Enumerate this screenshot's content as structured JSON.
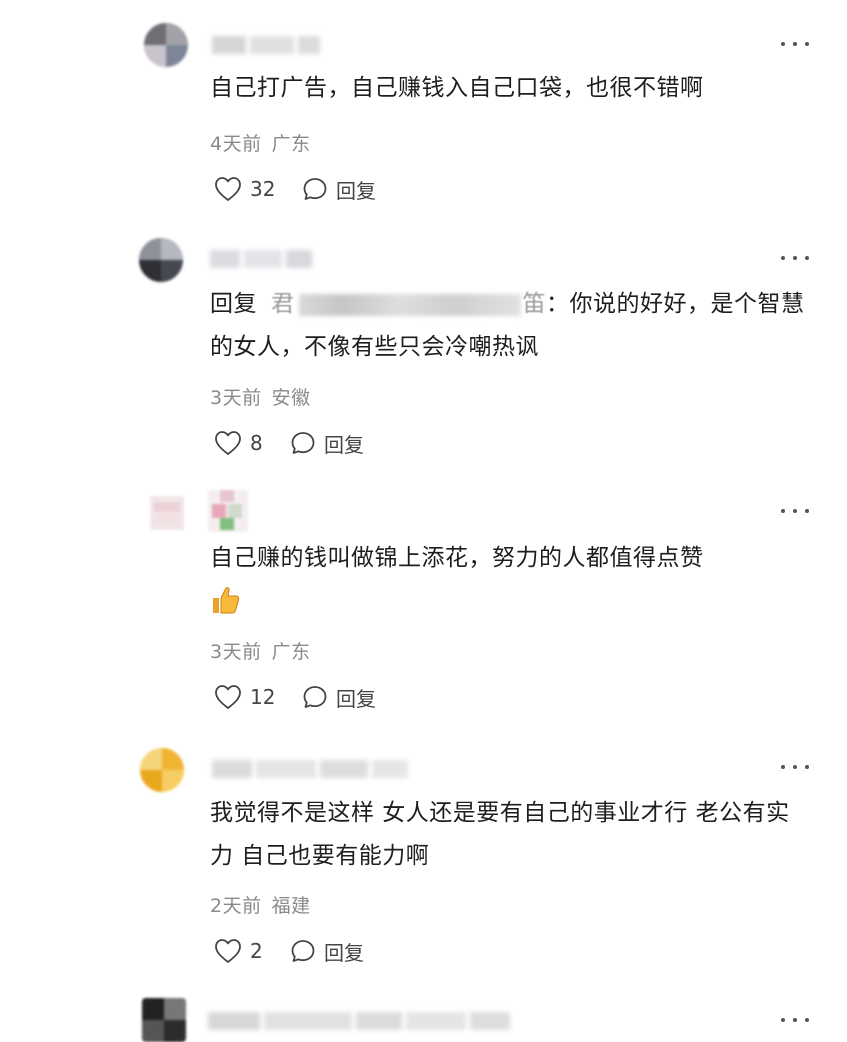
{
  "comments": [
    {
      "content": "自己打广告，自己赚钱入自己口袋，也很不错啊",
      "time": "4天前",
      "location": "广东",
      "likes": "32",
      "reply_label": "回复"
    },
    {
      "reply_prefix": "回复",
      "reply_target_head": "君",
      "reply_target_tail": "笛",
      "content": "：你说的好好，是个智慧的女人，不像有些只会冷嘲热讽",
      "time": "3天前",
      "location": "安徽",
      "likes": "8",
      "reply_label": "回复"
    },
    {
      "content": "自己赚的钱叫做锦上添花，努力的人都值得点赞",
      "emoji": "thumbs-up-emoji",
      "time": "3天前",
      "location": "广东",
      "likes": "12",
      "reply_label": "回复"
    },
    {
      "content": "我觉得不是这样 女人还是要有自己的事业才行 老公有实力 自己也要有能力啊",
      "time": "2天前",
      "location": "福建",
      "likes": "2",
      "reply_label": "回复"
    }
  ],
  "icons": {
    "like": "heart-icon",
    "reply": "speech-bubble-icon",
    "more": "more-dots-icon"
  },
  "colors": {
    "text": "#1e1e1e",
    "meta": "#8a8a8a",
    "icon": "#444444"
  }
}
